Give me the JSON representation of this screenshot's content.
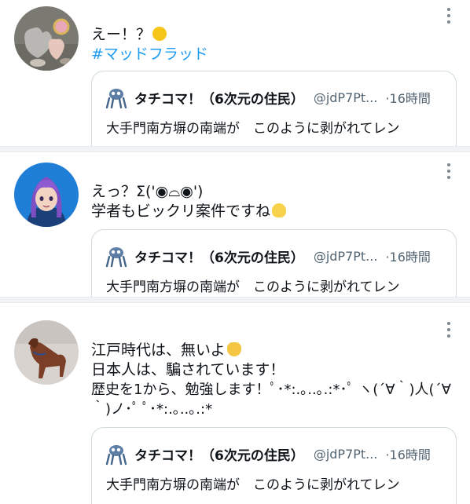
{
  "posts": [
    {
      "lines": [
        "えー！？"
      ],
      "hashtag": "#マッドフラッド",
      "emoji": "shushing-face-emoji",
      "quote": {
        "name": "タチコマ！（6次元の住民）",
        "handle": "@jdP7Pt...",
        "time": "·16時間",
        "text": "大手門南方塀の南端が　このように剥がれてレン"
      }
    },
    {
      "lines": [
        "えっ？Σ('◉⌓◉')",
        "学者もビックリ案件ですね"
      ],
      "emoji": "light-bulb-emoji",
      "quote": {
        "name": "タチコマ！（6次元の住民）",
        "handle": "@jdP7Pt...",
        "time": "·16時間",
        "text": "大手門南方塀の南端が　このように剥がれてレン"
      }
    },
    {
      "lines": [
        "江戸時代は、無いよ",
        "日本人は、騙されています！",
        "歴史を1から、勉強します！ﾟ･*:.｡..｡.:*･ﾟ ヽ(´∀｀)人(´∀",
        "｀)ノ･ﾟ ﾟ･*:.｡..｡.:*"
      ],
      "emoji": "victory-hand-emoji",
      "quote": {
        "name": "タチコマ！（6次元の住民）",
        "handle": "@jdP7Pt...",
        "time": "·16時間",
        "text": "大手門南方塀の南端が　このように剥がれてレン"
      }
    }
  ],
  "colors": {
    "link": "#1d9bf0",
    "muted": "#536471",
    "border": "#cfd9de",
    "separator": "#eff3f4"
  }
}
